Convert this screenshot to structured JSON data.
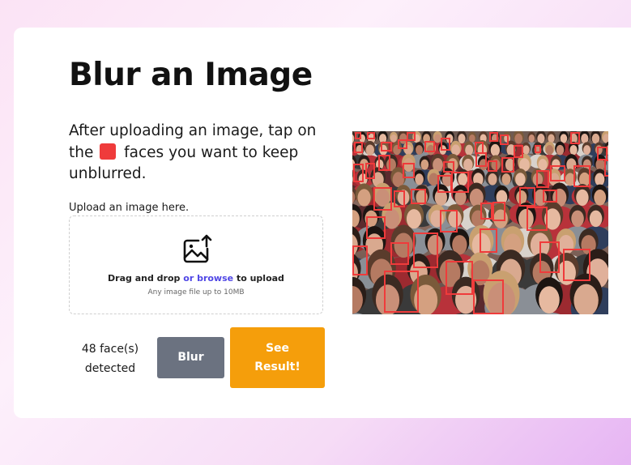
{
  "page": {
    "title": "Blur an Image",
    "instructions_before": "After uploading an image, tap on the",
    "instructions_after": "faces you want to keep unblurred.",
    "marker_color": "#ef3b3b"
  },
  "upload": {
    "label": "Upload an image here.",
    "drag_text": "Drag and drop",
    "browse_text": "or browse",
    "upload_text": "to upload",
    "hint": "Any image file up to 10MB",
    "icon": "image-upload-icon"
  },
  "status": {
    "face_count_line1": "48 face(s)",
    "face_count_line2": "detected"
  },
  "actions": {
    "blur_label": "Blur",
    "result_label_line1": "See",
    "result_label_line2": "Result!",
    "blur_color": "#6b7280",
    "result_color": "#f59e0b"
  },
  "preview": {
    "image_description_icon": "crowd-photo",
    "box_color": "#ef3b3b"
  }
}
